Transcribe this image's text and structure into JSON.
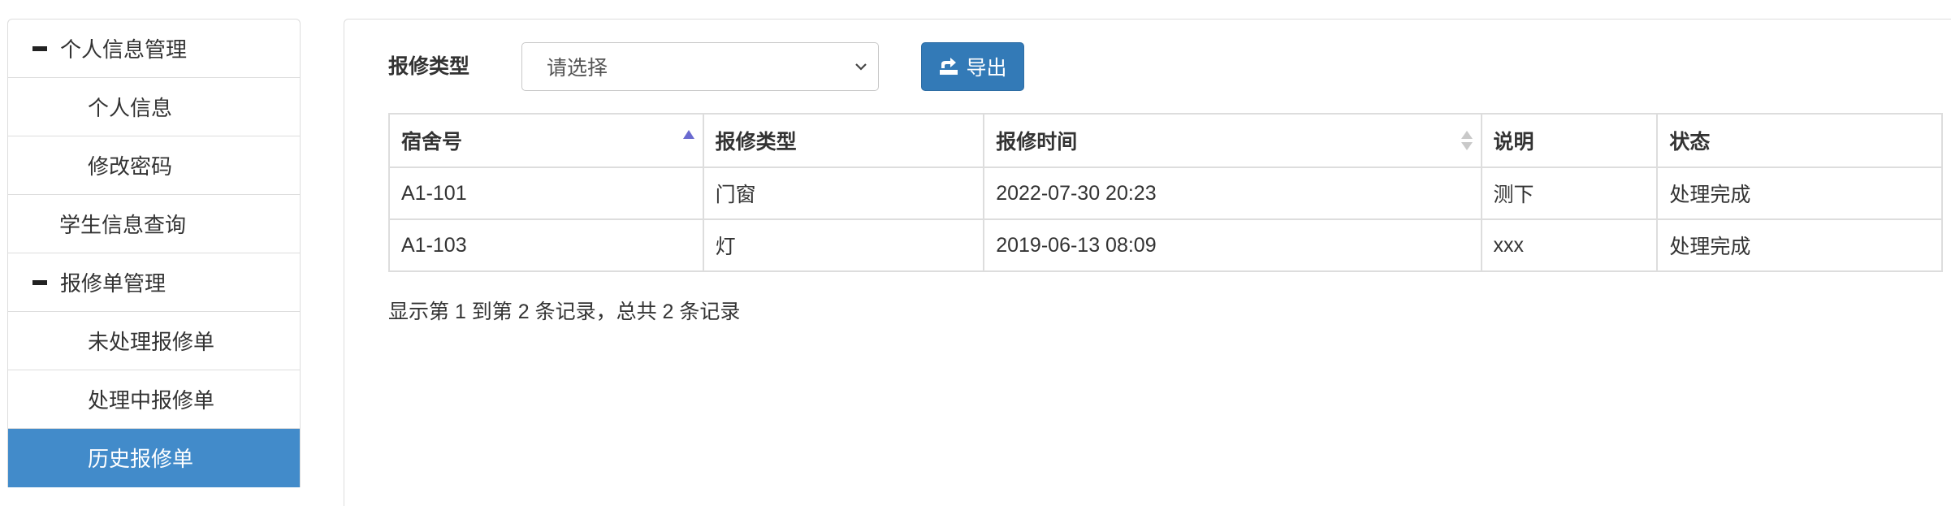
{
  "sidebar": {
    "items": [
      {
        "label": "个人信息管理",
        "kind": "group"
      },
      {
        "label": "个人信息",
        "kind": "sub"
      },
      {
        "label": "修改密码",
        "kind": "sub"
      },
      {
        "label": "学生信息查询",
        "kind": "top"
      },
      {
        "label": "报修单管理",
        "kind": "group"
      },
      {
        "label": "未处理报修单",
        "kind": "sub"
      },
      {
        "label": "处理中报修单",
        "kind": "sub"
      },
      {
        "label": "历史报修单",
        "kind": "sub",
        "active": true
      }
    ]
  },
  "filter": {
    "label": "报修类型",
    "select_value": "请选择",
    "export_label": "导出"
  },
  "table": {
    "columns": [
      "宿舍号",
      "报修类型",
      "报修时间",
      "说明",
      "状态"
    ],
    "rows": [
      [
        "A1-101",
        "门窗",
        "2022-07-30 20:23",
        "测下",
        "处理完成"
      ],
      [
        "A1-103",
        "灯",
        "2019-06-13 08:09",
        "xxx",
        "处理完成"
      ]
    ]
  },
  "pager": {
    "info": "显示第 1 到第 2 条记录，总共 2 条记录"
  },
  "colors": {
    "accent": "#428bca",
    "button": "#337ab7",
    "border": "#dddddd"
  }
}
